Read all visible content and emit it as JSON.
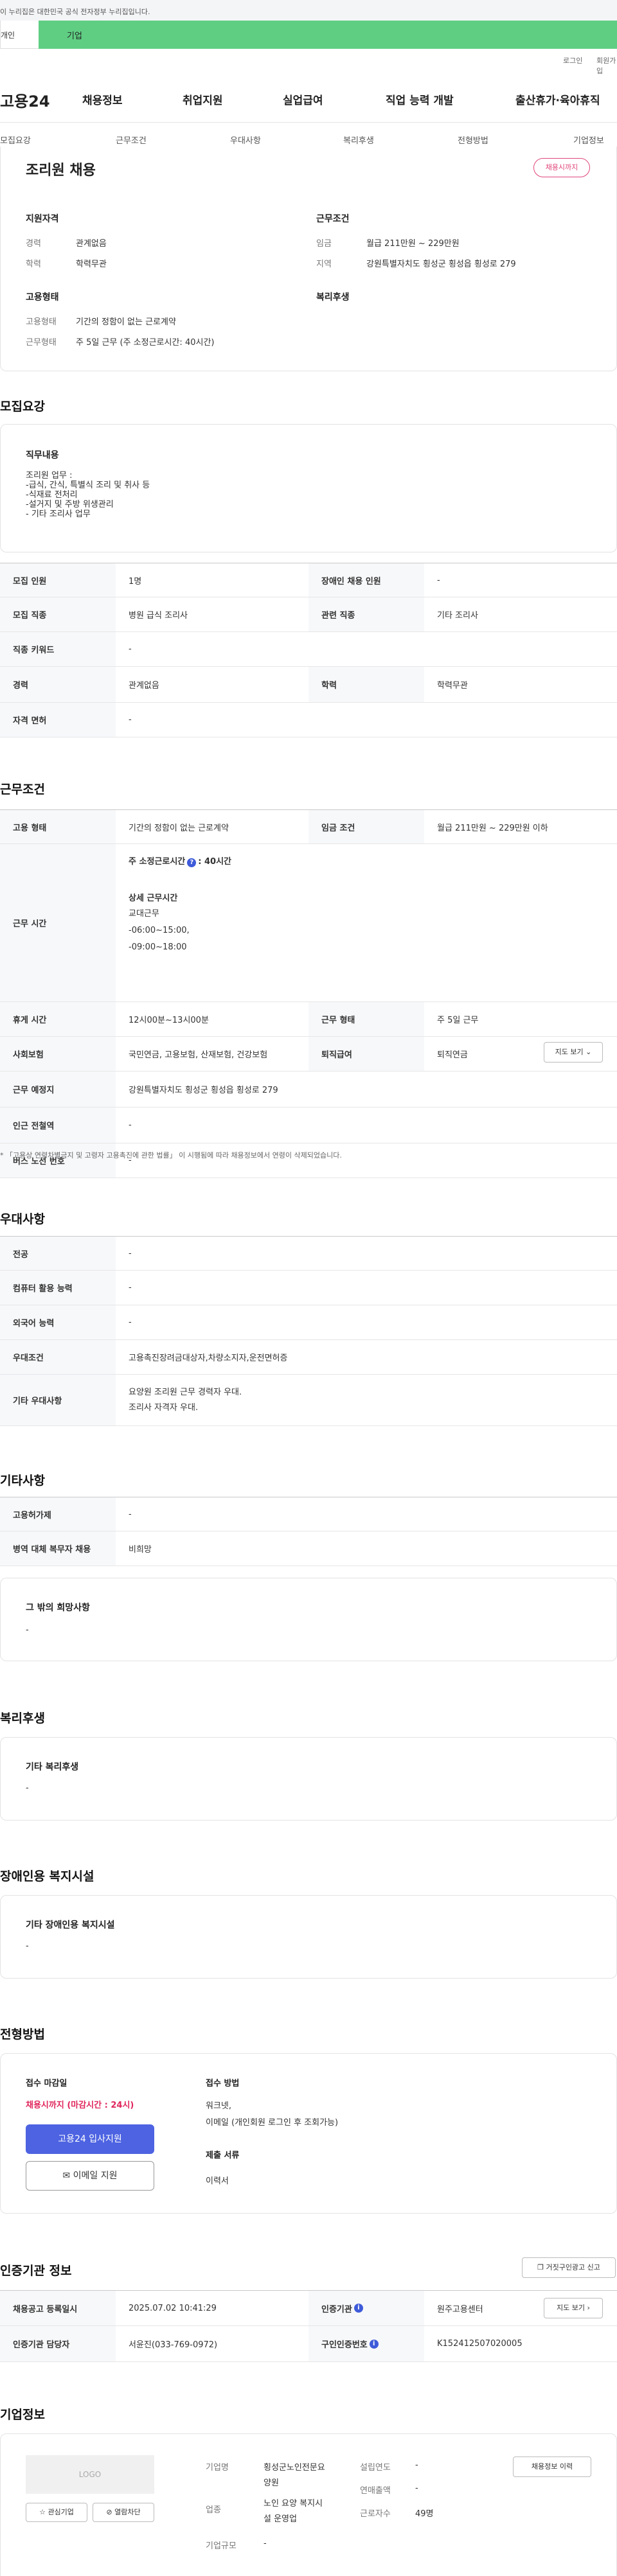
{
  "notice": "이 누리집은 대한민국 공식 전자정부 누리집입니다.",
  "user_tabs": {
    "personal": "개인",
    "company": "기업"
  },
  "util": {
    "login": "로그인",
    "join": "회원가입"
  },
  "logo": "고용24",
  "gnb": [
    "채용정보",
    "취업지원",
    "실업급여",
    "직업 능력 개발",
    "출산휴가·육아휴직"
  ],
  "snb": [
    "모집요강",
    "근무조건",
    "우대사항",
    "복리후생",
    "전형방법",
    "기업정보"
  ],
  "job": {
    "title": "조리원 채용",
    "badge": "채용시까지",
    "qual_title": "지원자격",
    "career_k": "경력",
    "career_v": "관계없음",
    "edu_k": "학력",
    "edu_v": "학력무관",
    "cond_title": "근무조건",
    "wage_k": "임금",
    "wage_v": "월급 211만원 ~ 229만원",
    "region_k": "지역",
    "region_v": "강원특별자치도 횡성군 횡성읍 횡성로 279",
    "emp_title": "고용형태",
    "emptype_k": "고용형태",
    "emptype_v": "기간의 정함이 없는 근로계약",
    "worktype_k": "근무형태",
    "worktype_v": "주 5일 근무 (주 소정근로시간: 40시간)",
    "welfare_title": "복리후생"
  },
  "recruit": {
    "heading": "모집요강",
    "duty_title": "직무내용",
    "duty_lines": [
      "조리원 업무 :",
      "-급식, 간식, 특별식 조리 및 취사 등",
      "-식재료 전처리",
      "-설거지 및 주방 위생관리",
      "- 기타 조리사 업무"
    ],
    "rows": [
      [
        "모집 인원",
        "1명",
        "장애인 채용 인원",
        "-"
      ],
      [
        "모집 직종",
        "병원 급식 조리사",
        "관련 직종",
        "기타 조리사"
      ],
      [
        "직종 키워드",
        "-",
        "",
        ""
      ],
      [
        "경력",
        "관계없음",
        "학력",
        "학력무관"
      ],
      [
        "자격 면허",
        "-",
        "",
        ""
      ]
    ]
  },
  "conditions": {
    "heading": "근무조건",
    "r1": [
      "고용 형태",
      "기간의 정함이 없는 근로계약",
      "임금 조건",
      "월급 211만원 ~ 229만원 이하"
    ],
    "worktime_k": "근무 시간",
    "worktime_week": "주 소정근로시간",
    "worktime_week_icon": "?",
    "worktime_week_v": ": 40시간",
    "worktime_detail_title": "상세 근무시간",
    "worktime_lines": [
      "교대근무",
      "-06:00~15:00,",
      "-09:00~18:00"
    ],
    "r3": [
      "휴게 시간",
      "12시00분~13시00분",
      "근무 형태",
      "주 5일 근무"
    ],
    "r4": [
      "사회보험",
      "국민연금, 고용보험, 산재보험, 건강보험",
      "퇴직급여",
      "퇴직연금"
    ],
    "r5": [
      "근무 예정지",
      "강원특별자치도 횡성군 횡성읍 횡성로 279"
    ],
    "map_btn": "지도 보기",
    "r6": [
      "인근 전철역",
      "-"
    ],
    "r7": [
      "버스 노선 번호",
      "-"
    ],
    "note": "* 「고용상 연령차별금지 및 고령자 고용촉진에 관한 법률」 이 시행됨에 따라 채용정보에서 연령이 삭제되었습니다."
  },
  "pref": {
    "heading": "우대사항",
    "rows": [
      [
        "전공",
        "-"
      ],
      [
        "컴퓨터 활용 능력",
        "-"
      ],
      [
        "외국어 능력",
        "-"
      ],
      [
        "우대조건",
        "고용촉진장려금대상자,차량소지자,운전면허증"
      ]
    ],
    "other_k": "기타 우대사항",
    "other_lines": [
      "요양원 조리원 근무 경력자 우대.",
      "조리사 자격자 우대."
    ]
  },
  "etc": {
    "heading": "기타사항",
    "rows": [
      [
        "고용허가제",
        "-"
      ],
      [
        "병역 대체 복무자 채용",
        "비희망"
      ]
    ],
    "hope_title": "그 밖의 희망사항",
    "hope_v": "-"
  },
  "welfare": {
    "heading": "복리후생",
    "title": "기타 복리후생",
    "v": "-"
  },
  "disabled": {
    "heading": "장애인용 복지시설",
    "title": "기타 장애인용 복지시설",
    "v": "-"
  },
  "process": {
    "heading": "전형방법",
    "deadline_title": "접수 마감일",
    "deadline_v": "채용시까지 (마감시간 : 24시)",
    "apply_btn": "고용24 입사지원",
    "email_btn": "이메일 지원",
    "method_title": "접수 방법",
    "method_lines": [
      "워크넷,",
      "이메일 (개인회원 로그인 후 조회가능)"
    ],
    "docs_title": "제출 서류",
    "docs_v": "이력서"
  },
  "cert": {
    "heading": "인증기관 정보",
    "report_btn": "거짓구인광고 신고",
    "date_k": "채용공고 등록일시",
    "date_v": "2025.07.02 10:41:29",
    "org_k": "인증기관",
    "org_v": "원주고용센터",
    "map_btn": "지도 보기",
    "mgr_k": "인증기관 담당자",
    "mgr_v": "서윤진(033-769-0972)",
    "no_k": "구인인증번호",
    "no_v": "K152412507020005"
  },
  "company": {
    "heading": "기업정보",
    "logo": "LOGO",
    "fav_btn": "관심기업",
    "block_btn": "열람차단",
    "hist_btn": "채용정보 이력",
    "name_k": "기업명",
    "name_lines": [
      "횡성군노인전문요",
      "양원"
    ],
    "ind_k": "업종",
    "ind_lines": [
      "노인 요양 복지시",
      "설 운영업"
    ],
    "scale_k": "기업규모",
    "scale_v": "-",
    "est_k": "설립연도",
    "est_v": "-",
    "sales_k": "연매출액",
    "sales_v": "-",
    "emp_k": "근로자수",
    "emp_v": "49명"
  }
}
